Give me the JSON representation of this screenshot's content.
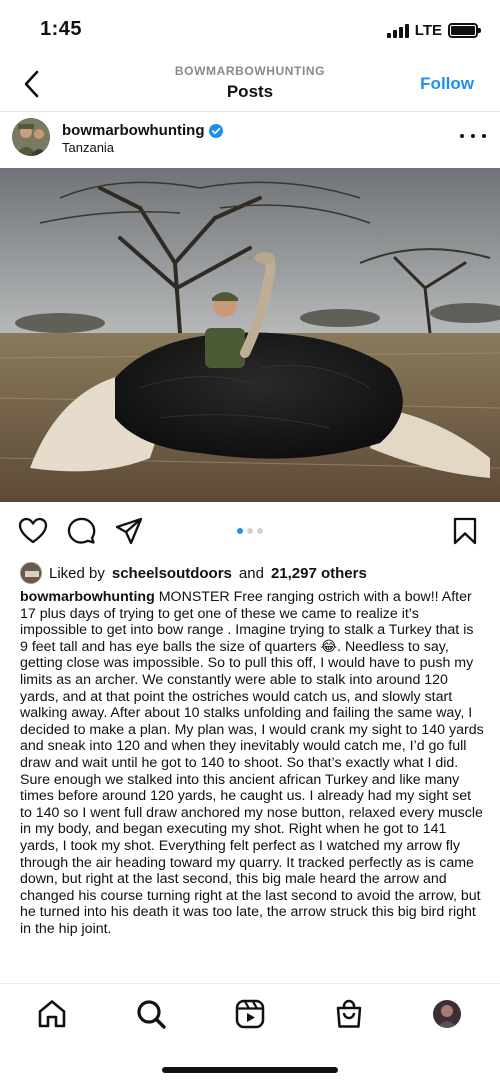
{
  "status_bar": {
    "time": "1:45",
    "network": "LTE"
  },
  "header": {
    "username": "BOWMARBOWHUNTING",
    "title": "Posts",
    "follow_label": "Follow"
  },
  "post": {
    "username": "bowmarbowhunting",
    "location": "Tanzania",
    "verified": true,
    "carousel": {
      "total": 3,
      "active": 1
    },
    "likes": {
      "liked_by_prefix": "Liked by",
      "liked_by_user": "scheelsoutdoors",
      "and_text": "and",
      "others": "21,297 others"
    },
    "caption_username": "bowmarbowhunting",
    "caption_text": "MONSTER Free ranging ostrich with a bow!! After 17 plus days of trying to get one of these we came to realize it’s impossible to get into bow range . Imagine trying to stalk a Turkey that is 9 feet tall and has eye balls the size of quarters 😂. Needless to say, getting close was impossible. So to pull this off, I would have to  push my limits as an archer. We constantly were able to stalk into around 120 yards, and at that point the ostriches would catch us, and slowly start walking away. After about 10 stalks unfolding and failing the same way, I decided to make a plan. My plan was, I would crank my sight to 140 yards and sneak into 120 and when they inevitably would catch me, I’d go full draw and wait until he got to 140 to shoot. So that’s exactly what I did. Sure enough we stalked into this ancient african Turkey and like many times before around 120 yards, he caught us. I already had my sight set to 140 so I went full draw anchored my nose button, relaxed every muscle in my body, and began executing my shot. Right when he got to 141 yards, I took my shot. Everything felt perfect as I watched my arrow fly through the air heading toward my quarry. It tracked perfectly as is came down, but right at the last second, this big male heard the arrow and changed his course turning right at the last second to avoid the arrow, but he turned into his death it was too late, the arrow struck this big bird right in the hip joint."
  },
  "icons": {
    "back": "chevron-left-icon",
    "verified": "verified-badge-icon",
    "more": "more-horizontal-icon",
    "like": "heart-icon",
    "comment": "comment-icon",
    "share": "send-icon",
    "save": "bookmark-icon",
    "home": "home-icon",
    "search": "search-icon",
    "reels": "reels-icon",
    "shop": "shop-bag-icon",
    "profile": "profile-avatar"
  },
  "colors": {
    "accent": "#1e8ff0",
    "text": "#111111",
    "muted": "#8a8a8a"
  }
}
